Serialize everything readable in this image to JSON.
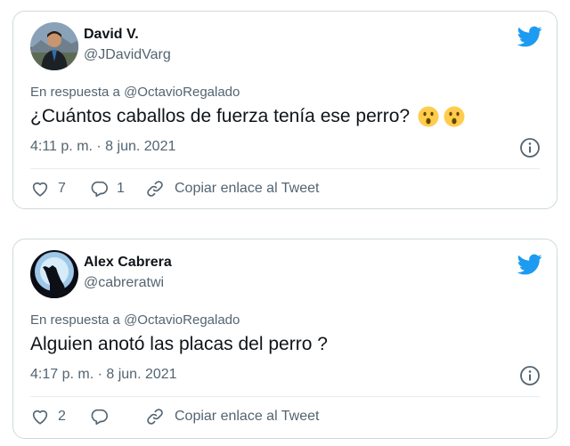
{
  "colors": {
    "twitter_blue": "#1d9bf0",
    "text_primary": "#0f1419",
    "text_secondary": "#536471",
    "border": "#cfd9de",
    "emoji_yellow": "#ffcc4d"
  },
  "tweets": [
    {
      "display_name": "David V.",
      "handle": "@JDavidVarg",
      "avatar_icon": "profile-photo",
      "reply_context": "En respuesta a @OctavioRegalado",
      "text": "¿Cuántos caballos de fuerza tenía ese perro?",
      "emojis": [
        "hushed-face-emoji",
        "hushed-face-emoji"
      ],
      "timestamp": "4:11 p. m. · 8 jun. 2021",
      "like_count": "7",
      "reply_count": "1",
      "copy_link_label": "Copiar enlace al Tweet"
    },
    {
      "display_name": "Alex Cabrera",
      "handle": "@cabreratwi",
      "avatar_icon": "howling-wolf-moon",
      "reply_context": "En respuesta a @OctavioRegalado",
      "text": "Alguien anotó las placas del perro ?",
      "emojis": [],
      "timestamp": "4:17 p. m. · 8 jun. 2021",
      "like_count": "2",
      "reply_count": "",
      "copy_link_label": "Copiar enlace al Tweet"
    }
  ]
}
